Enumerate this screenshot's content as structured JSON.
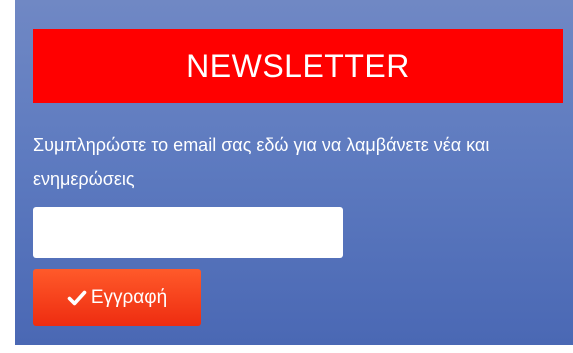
{
  "newsletter": {
    "title": "NEWSLETTER",
    "description": "Συμπληρώστε το email σας εδώ για να λαμβάνετε νέα και ενημερώσεις",
    "email_value": "",
    "email_placeholder": "",
    "submit_label": "Εγγραφή",
    "submit_icon": "check-icon"
  },
  "colors": {
    "banner": "#ff0000",
    "panel": "#5e7bc0",
    "button": "#f5401a",
    "text": "#ffffff"
  }
}
